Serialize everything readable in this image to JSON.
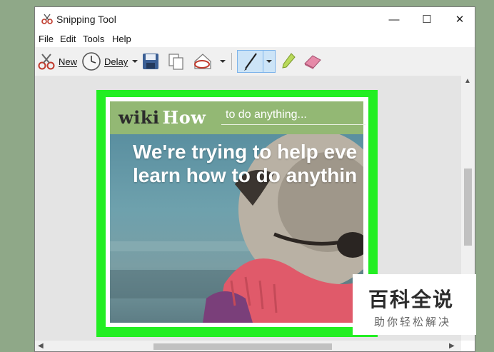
{
  "window": {
    "title": "Snipping Tool",
    "minimize_glyph": "—",
    "maximize_glyph": "☐",
    "close_glyph": "✕"
  },
  "menu": [
    "File",
    "Edit",
    "Tools",
    "Help"
  ],
  "toolbar": {
    "new_label": "New",
    "delay_label": "Delay",
    "selected_tool": "pen"
  },
  "snip": {
    "logo_wiki": "wiki",
    "logo_how": "How",
    "search_placeholder": "to do anything...",
    "hero_line1": "We're trying to help eve",
    "hero_line2": "learn how to do anythin",
    "border_color": "#22ee22"
  },
  "watermark": {
    "main": "百科全说",
    "sub": "助你轻松解决"
  }
}
